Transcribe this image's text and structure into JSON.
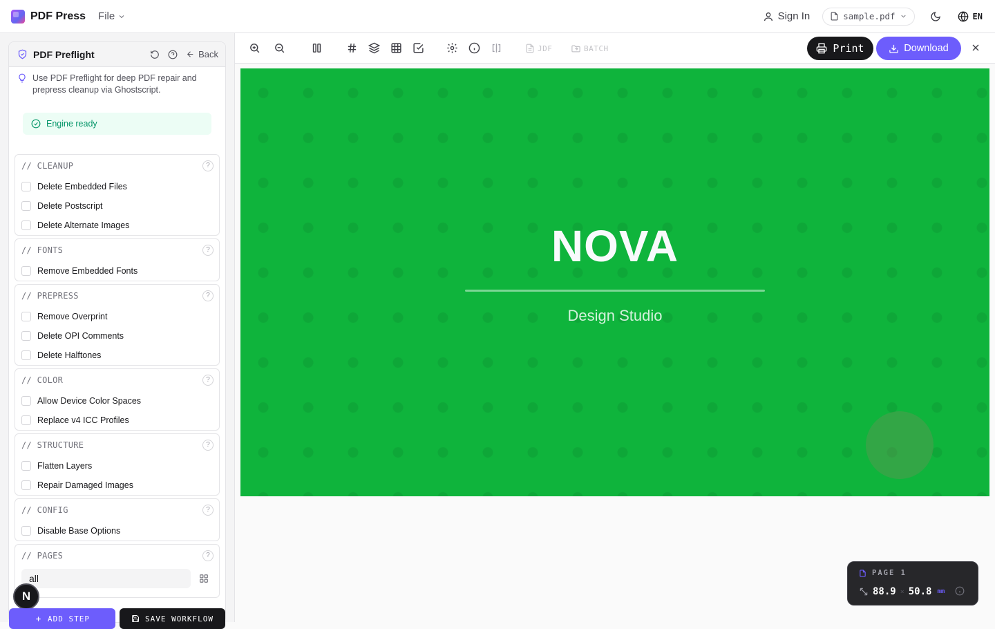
{
  "app": {
    "name": "PDF Press",
    "file_menu": "File"
  },
  "header": {
    "sign_in": "Sign In",
    "file_name": "sample.pdf",
    "language": "EN"
  },
  "sidebar": {
    "title": "PDF Preflight",
    "back": "Back",
    "hint": "Use PDF Preflight for deep PDF repair and prepress cleanup via Ghostscript.",
    "engine_status": "Engine ready",
    "sections": [
      {
        "title": "// CLEANUP",
        "options": [
          "Delete Embedded Files",
          "Delete Postscript",
          "Delete Alternate Images"
        ]
      },
      {
        "title": "// FONTS",
        "options": [
          "Remove Embedded Fonts"
        ]
      },
      {
        "title": "// PREPRESS",
        "options": [
          "Remove Overprint",
          "Delete OPI Comments",
          "Delete Halftones"
        ]
      },
      {
        "title": "// COLOR",
        "options": [
          "Allow Device Color Spaces",
          "Replace v4 ICC Profiles"
        ]
      },
      {
        "title": "// STRUCTURE",
        "options": [
          "Flatten Layers",
          "Repair Damaged Images"
        ]
      },
      {
        "title": "// CONFIG",
        "options": [
          "Disable Base Options"
        ]
      }
    ],
    "pages": {
      "title": "// PAGES",
      "value": "all"
    },
    "add_step": "ADD STEP",
    "save_workflow": "SAVE WORKFLOW",
    "avatar_letter": "N"
  },
  "toolbar": {
    "jdf": "JDF",
    "batch": "BATCH",
    "print": "Print",
    "download": "Download"
  },
  "document": {
    "title": "NOVA",
    "subtitle": "Design Studio",
    "background": "#0fb43c"
  },
  "page_info": {
    "label": "PAGE 1",
    "width": "88.9",
    "height": "50.8",
    "unit": "mm"
  },
  "colors": {
    "accent": "#6d5dfc",
    "success": "#059669",
    "dark": "#18181b"
  }
}
